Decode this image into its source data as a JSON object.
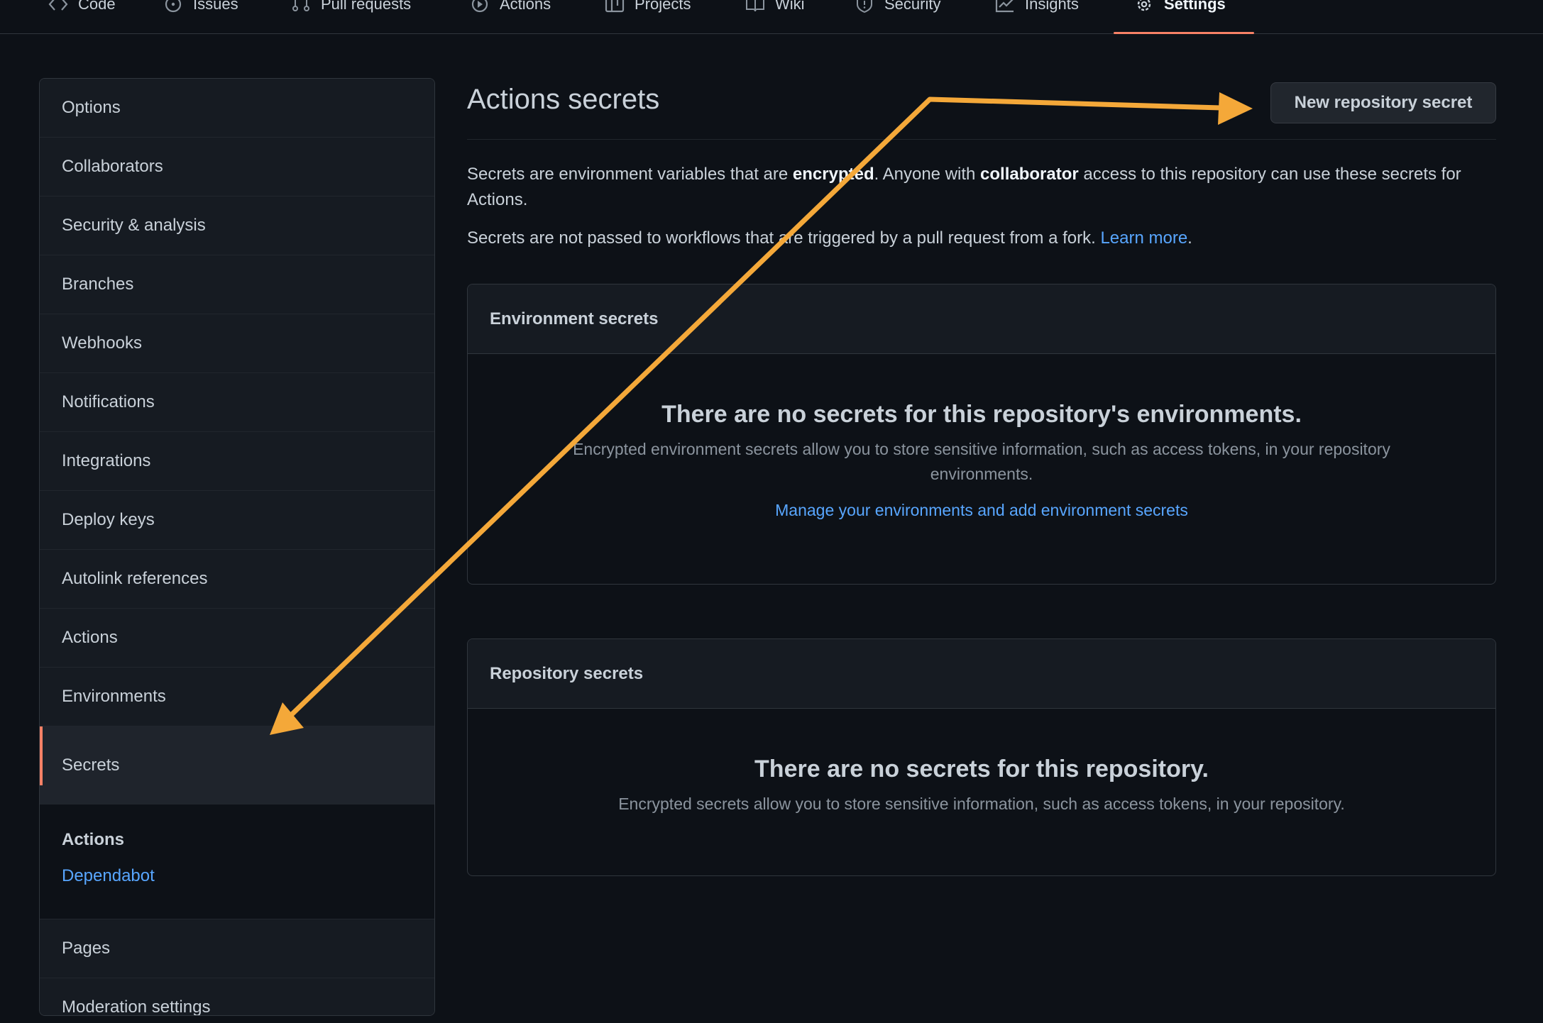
{
  "nav": {
    "tabs": [
      {
        "label": "Code",
        "icon": "code-icon"
      },
      {
        "label": "Issues",
        "icon": "issue-icon"
      },
      {
        "label": "Pull requests",
        "icon": "pull-request-icon"
      },
      {
        "label": "Actions",
        "icon": "play-icon"
      },
      {
        "label": "Projects",
        "icon": "project-icon"
      },
      {
        "label": "Wiki",
        "icon": "book-icon"
      },
      {
        "label": "Security",
        "icon": "shield-icon"
      },
      {
        "label": "Insights",
        "icon": "graph-icon"
      },
      {
        "label": "Settings",
        "icon": "gear-icon",
        "selected": true
      }
    ]
  },
  "sidebar": {
    "items": [
      "Options",
      "Collaborators",
      "Security & analysis",
      "Branches",
      "Webhooks",
      "Notifications",
      "Integrations",
      "Deploy keys",
      "Autolink references",
      "Actions",
      "Environments",
      "Secrets"
    ],
    "selected": "Secrets",
    "sub_heading": "Actions",
    "sub_link": "Dependabot",
    "bottom_items": [
      "Pages",
      "Moderation settings"
    ]
  },
  "main": {
    "title": "Actions secrets",
    "new_button": "New repository secret",
    "desc1_a": "Secrets are environment variables that are ",
    "desc1_b": "encrypted",
    "desc1_c": ". Anyone with ",
    "desc1_d": "collaborator",
    "desc1_e": " access to this repository can use these secrets for Actions.",
    "desc2_a": "Secrets are not passed to workflows that are triggered by a pull request from a fork. ",
    "desc2_link": "Learn more",
    "desc2_b": ".",
    "env_box": {
      "header": "Environment secrets",
      "empty_title": "There are no secrets for this repository's environments.",
      "empty_desc": "Encrypted environment secrets allow you to store sensitive information, such as access tokens, in your repository environments.",
      "link": "Manage your environments and add environment secrets"
    },
    "repo_box": {
      "header": "Repository secrets",
      "empty_title": "There are no secrets for this repository.",
      "empty_desc": "Encrypted secrets allow you to store sensitive information, such as access tokens, in your repository."
    }
  },
  "annotation": {
    "arrow_color": "#f4a839"
  },
  "colors": {
    "background": "#0d1117",
    "accent_underline": "#f78166",
    "link": "#58a6ff"
  }
}
